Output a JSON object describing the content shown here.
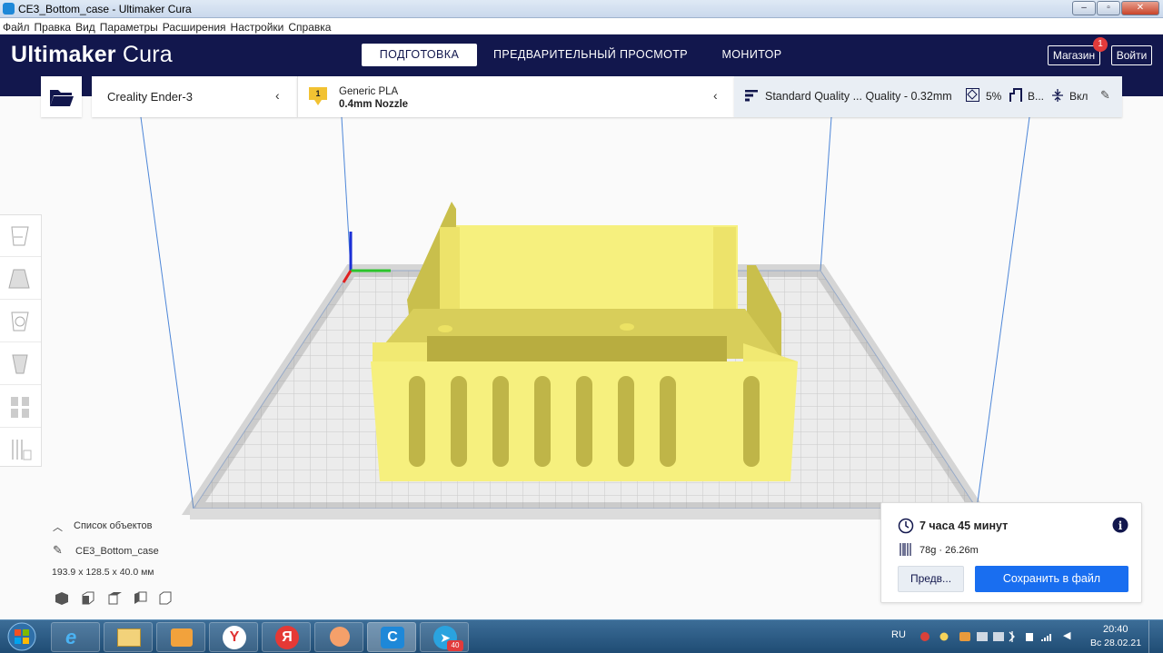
{
  "window": {
    "title": "CE3_Bottom_case - Ultimaker Cura",
    "controls": {
      "minimize": "–",
      "maximize": "▫",
      "close": "✕"
    }
  },
  "menu": [
    "Файл",
    "Правка",
    "Вид",
    "Параметры",
    "Расширения",
    "Настройки",
    "Справка"
  ],
  "header": {
    "logo_brand": "Ultimaker",
    "logo_product": "Cura",
    "tabs": [
      {
        "label": "ПОДГОТОВКА",
        "active": true
      },
      {
        "label": "ПРЕДВАРИТЕЛЬНЫЙ ПРОСМОТР",
        "active": false
      },
      {
        "label": "МОНИТОР",
        "active": false
      }
    ],
    "marketplace_label": "Магазин",
    "marketplace_badge": "1",
    "login_label": "Войти"
  },
  "printer": {
    "name": "Creality Ender-3"
  },
  "material": {
    "badge": "1",
    "name": "Generic PLA",
    "nozzle": "0.4mm Nozzle"
  },
  "print_settings": {
    "profile": "Standard Quality ... Quality - 0.32mm",
    "infill": "5%",
    "support": "В...",
    "adhesion": "Вкл"
  },
  "object_list": {
    "header": "Список объектов",
    "object_name": "CE3_Bottom_case",
    "dimensions": "193.9 x 128.5 x 40.0 мм"
  },
  "print_info": {
    "time": "7 часа 45 минут",
    "material_usage": "78g · 26.26m",
    "preview_label": "Предв...",
    "save_label": "Сохранить в файл"
  },
  "taskbar": {
    "language": "RU",
    "time": "20:40",
    "date": "Вс 28.02.21",
    "telegram_badge": "40"
  },
  "colors": {
    "header_bg": "#12174d",
    "model_yellow": "#f6f07e",
    "primary_button": "#196ef0"
  }
}
